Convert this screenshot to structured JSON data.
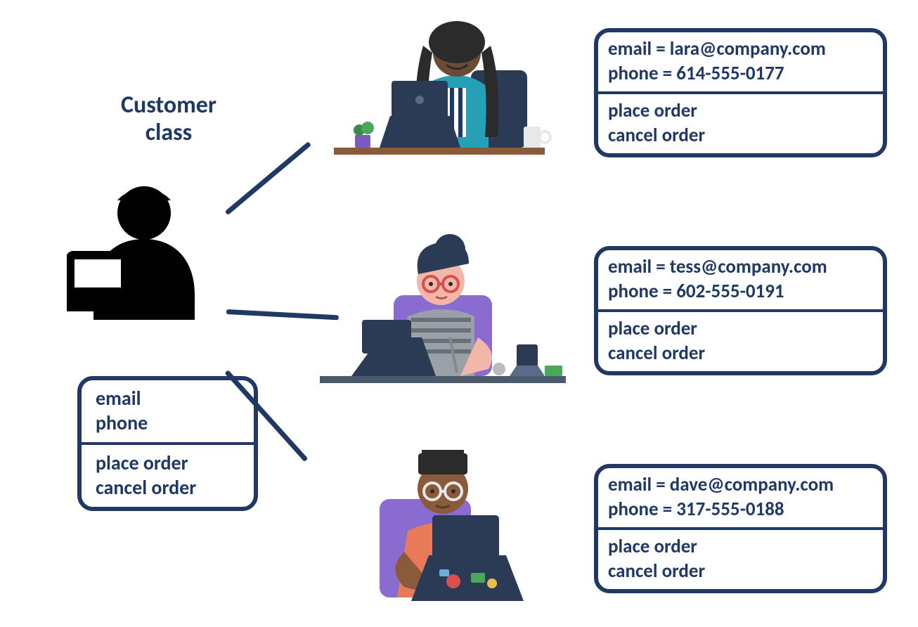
{
  "title_line1": "Customer",
  "title_line2": "class",
  "class_box": {
    "attr1": "email",
    "attr2": "phone",
    "method1": "place order",
    "method2": "cancel order"
  },
  "instances": [
    {
      "email": "email = lara@company.com",
      "phone": "phone = 614-555-0177",
      "method1": "place order",
      "method2": "cancel order"
    },
    {
      "email": "email = tess@company.com",
      "phone": "phone = 602-555-0191",
      "method1": "place order",
      "method2": "cancel order"
    },
    {
      "email": "email = dave@company.com",
      "phone": "phone = 317-555-0188",
      "method1": "place order",
      "method2": "cancel order"
    }
  ]
}
